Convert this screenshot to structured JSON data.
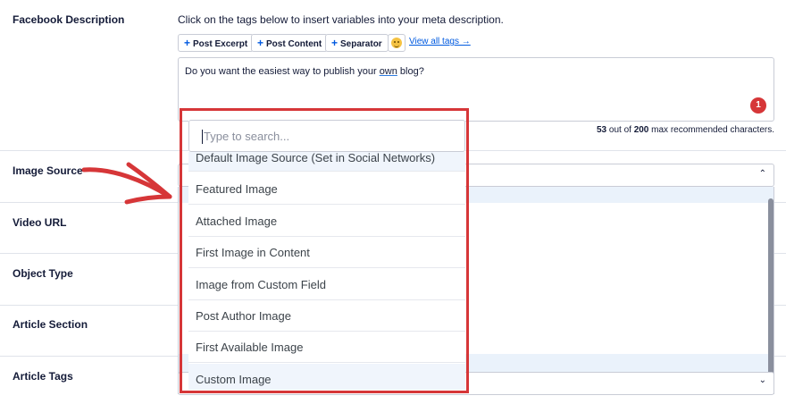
{
  "labels": {
    "facebook_description": "Facebook Description",
    "image_source": "Image Source",
    "video_url": "Video URL",
    "object_type": "Object Type",
    "article_section": "Article Section",
    "article_tags": "Article Tags"
  },
  "description_field": {
    "hint": "Click on the tags below to insert variables into your meta description.",
    "tags": [
      "Post Excerpt",
      "Post Content",
      "Separator"
    ],
    "view_all": "View all tags →",
    "text_before": "Do you want the easiest way to publish your ",
    "text_underlined": "own",
    "text_after": " blog?",
    "badge_count": "1",
    "char_count": "53",
    "char_middle": " out of ",
    "char_max": "200",
    "char_suffix": " max recommended characters."
  },
  "dropdown": {
    "search_placeholder": "Type to search...",
    "options": [
      "Default Image Source (Set in Social Networks)",
      "Featured Image",
      "Attached Image",
      "First Image in Content",
      "Image from Custom Field",
      "Post Author Image",
      "First Available Image",
      "Custom Image"
    ]
  },
  "colors": {
    "accent": "#005ae0",
    "highlight_box": "#d63638",
    "badge": "#d63638"
  }
}
